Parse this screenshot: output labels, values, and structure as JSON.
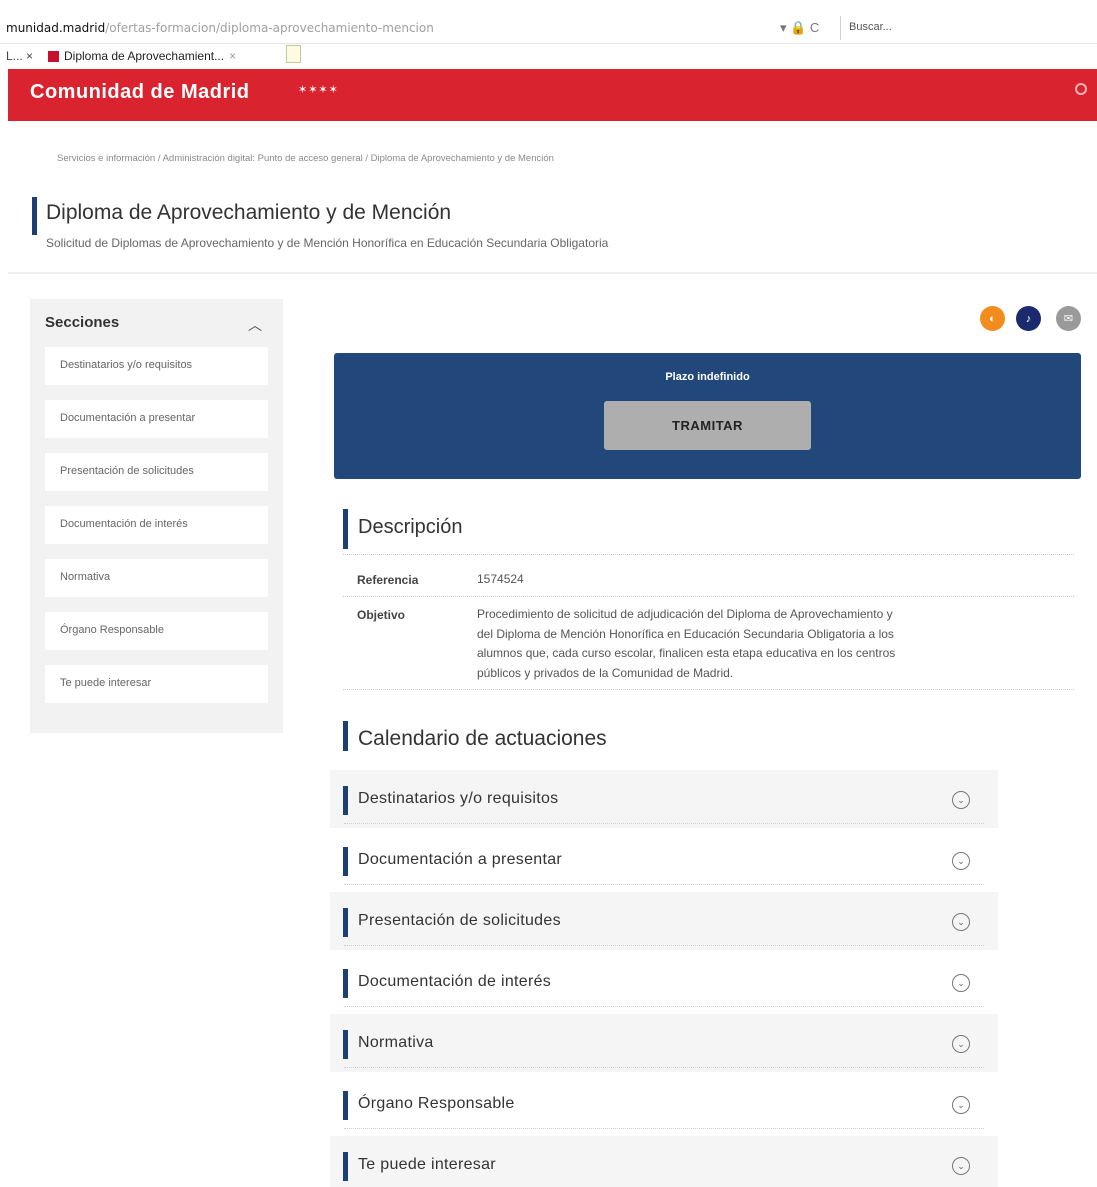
{
  "browser": {
    "url_host": "munidad.madrid",
    "url_path": "/ofertas-formacion/diploma-aprovechamiento-mencion",
    "url_controls": "▾ 🔒 C",
    "search_placeholder": "Buscar...",
    "prev_tab": "L... ×",
    "tab_title": "Diploma de Aprovechamient...",
    "tab_close": "×"
  },
  "header": {
    "brand": "Comunidad de Madrid",
    "stars": "✶✶✶✶"
  },
  "breadcrumb": "Servicios e información / Administración digital: Punto de acceso general / Diploma de Aprovechamiento y de Mención",
  "page": {
    "title": "Diploma de Aprovechamiento y de Mención",
    "subtitle": "Solicitud de Diplomas de Aprovechamiento y de Mención Honorífica en Educación Secundaria Obligatoria"
  },
  "sidebar": {
    "heading": "Secciones",
    "items": [
      {
        "label": "Destinatarios y/o requisitos"
      },
      {
        "label": "Documentación a presentar"
      },
      {
        "label": "Presentación de solicitudes"
      },
      {
        "label": "Documentación de interés"
      },
      {
        "label": "Normativa"
      },
      {
        "label": "Órgano Responsable"
      },
      {
        "label": "Te puede interesar"
      }
    ]
  },
  "share": {
    "listen_icon": "speaker-icon",
    "alert_icon": "bell-icon",
    "mail_icon": "mail-icon",
    "listen_glyph": "◐",
    "alert_glyph": "♪",
    "mail_glyph": "✉"
  },
  "plazo": {
    "label": "Plazo indefinido",
    "button": "TRAMITAR"
  },
  "descripcion": {
    "title": "Descripción",
    "referencia_label": "Referencia",
    "referencia_value": "1574524",
    "objetivo_label": "Objetivo",
    "objetivo_lines": [
      "Procedimiento de solicitud de adjudicación del Diploma de Aprovechamiento y",
      "del Diploma de Mención Honorífica en Educación Secundaria Obligatoria a los",
      "alumnos que, cada curso escolar, finalicen esta etapa educativa en los centros",
      "públicos y privados de la Comunidad de Madrid."
    ]
  },
  "calendario": {
    "title": "Calendario de actuaciones"
  },
  "accordion": [
    {
      "label": "Destinatarios y/o requisitos"
    },
    {
      "label": "Documentación a presentar"
    },
    {
      "label": "Presentación de solicitudes"
    },
    {
      "label": "Documentación de interés"
    },
    {
      "label": "Normativa"
    },
    {
      "label": "Órgano Responsable"
    },
    {
      "label": "Te puede interesar"
    }
  ],
  "accordion_icon": "⌄",
  "accent_colors": {
    "header_red": "#d9232f",
    "navy": "#22477b",
    "section_bar": "#1e3f73"
  }
}
